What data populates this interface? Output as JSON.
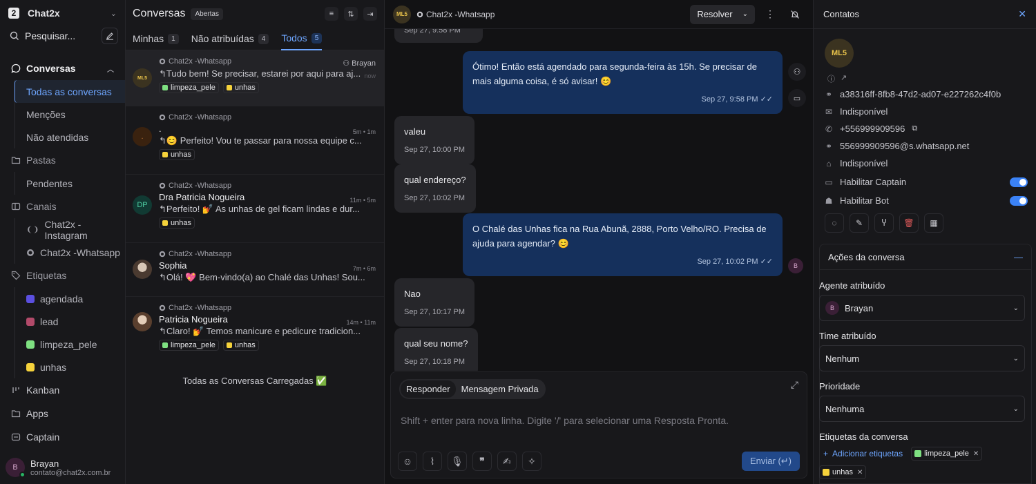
{
  "sidebar": {
    "logo": "2",
    "workspace": "Chat2x",
    "search_label": "Pesquisar...",
    "nav": {
      "conversas": "Conversas",
      "sub_conversas": [
        "Todas as conversas",
        "Menções",
        "Não atendidas"
      ],
      "pastas": "Pastas",
      "sub_pastas": [
        "Pendentes"
      ],
      "canais": "Canais",
      "sub_canais": [
        "Chat2x - Instagram",
        "Chat2x -Whatsapp"
      ],
      "etiquetas": "Etiquetas",
      "sub_etiquetas": [
        {
          "label": "agendada",
          "color": "#5b4fe0"
        },
        {
          "label": "lead",
          "color": "#b24a6a"
        },
        {
          "label": "limpeza_pele",
          "color": "#7ee081"
        },
        {
          "label": "unhas",
          "color": "#f5d23b"
        }
      ],
      "kanban": "Kanban",
      "apps": "Apps",
      "captain": "Captain"
    },
    "user": {
      "initial": "B",
      "name": "Brayan",
      "email": "contato@chat2x.com.br"
    }
  },
  "conversations": {
    "title": "Conversas",
    "status_badge": "Abertas",
    "tabs": [
      {
        "label": "Minhas",
        "count": "1"
      },
      {
        "label": "Não atribuídas",
        "count": "4"
      },
      {
        "label": "Todos",
        "count": "5"
      }
    ],
    "items": [
      {
        "inbox": "Chat2x -Whatsapp",
        "name": "",
        "agent": "Brayan",
        "time": "now",
        "message": "↰Tudo bem! Se precisar, estarei por aqui para aj...",
        "labels": [
          "limpeza_pele",
          "unhas"
        ]
      },
      {
        "inbox": "Chat2x -Whatsapp",
        "name": ".",
        "agent": "",
        "time": "5m • 1m",
        "message": "↰😊 Perfeito! Vou te passar para nossa equipe c...",
        "labels": [
          "unhas"
        ]
      },
      {
        "inbox": "Chat2x -Whatsapp",
        "name": "Dra Patricia Nogueira",
        "initials": "DP",
        "agent": "",
        "time": "11m • 5m",
        "message": "↰Perfeito! 💅 As unhas de gel ficam lindas e dur...",
        "labels": [
          "unhas"
        ]
      },
      {
        "inbox": "Chat2x -Whatsapp",
        "name": "Sophia",
        "agent": "",
        "time": "7m • 6m",
        "message": "↰Olá! 💖 Bem-vindo(a) ao Chalé das Unhas! Sou...",
        "labels": []
      },
      {
        "inbox": "Chat2x -Whatsapp",
        "name": "Patricia Nogueira",
        "agent": "",
        "time": "14m • 11m",
        "message": "↰Claro! 💅 Temos manicure e pedicure tradicion...",
        "labels": [
          "limpeza_pele",
          "unhas"
        ]
      }
    ],
    "loaded_text": "Todas as Conversas Carregadas ✅"
  },
  "chat": {
    "avatar_text": "ML5",
    "inbox_name": "Chat2x -Whatsapp",
    "resolve_label": "Resolver",
    "messages": [
      {
        "dir": "in",
        "text": "",
        "time": "Sep 27, 9:58 PM"
      },
      {
        "dir": "out",
        "text": "Ótimo! Então está agendado para segunda-feira às 15h. Se precisar de mais alguma coisa, é só avisar! 😊",
        "time": "Sep 27, 9:58 PM"
      },
      {
        "dir": "in",
        "text": "valeu",
        "time": "Sep 27, 10:00 PM"
      },
      {
        "dir": "in",
        "text": "qual endereço?",
        "time": "Sep 27, 10:02 PM"
      },
      {
        "dir": "out",
        "text": "O Chalé das Unhas fica na Rua Abunã, 2888, Porto Velho/RO. Precisa de ajuda para agendar? 😊",
        "time": "Sep 27, 10:02 PM"
      },
      {
        "dir": "in",
        "text": "Nao",
        "time": "Sep 27, 10:17 PM"
      },
      {
        "dir": "in",
        "text": "qual seu nome?",
        "time": "Sep 27, 10:18 PM"
      }
    ],
    "composer": {
      "mode_reply": "Responder",
      "mode_private": "Mensagem Privada",
      "placeholder": "Shift + enter para nova linha. Digite '/' para selecionar uma Resposta Pronta.",
      "send_label": "Enviar (↵)"
    }
  },
  "contact": {
    "title": "Contatos",
    "avatar_text": "ML5",
    "id": "a38316ff-8fb8-47d2-ad07-e227262c4f0b",
    "email": "Indisponível",
    "phone": "+556999909596",
    "whatsapp": "556999909596@s.whatsapp.net",
    "company": "Indisponível",
    "captain_label": "Habilitar Captain",
    "bot_label": "Habilitar Bot",
    "actions_title": "Ações da conversa",
    "agent_label": "Agente atribuído",
    "agent_value": "Brayan",
    "agent_initial": "B",
    "team_label": "Time atribuído",
    "team_value": "Nenhum",
    "priority_label": "Prioridade",
    "priority_value": "Nenhuma",
    "labels_title": "Etiquetas da conversa",
    "add_labels": "Adicionar etiquetas",
    "labels": [
      {
        "label": "limpeza_pele",
        "color": "#7ee081"
      },
      {
        "label": "unhas",
        "color": "#f5d23b"
      }
    ]
  },
  "colors": {
    "accent": "#6ea6ff",
    "outgoing": "#15305c",
    "online": "#28b463"
  }
}
